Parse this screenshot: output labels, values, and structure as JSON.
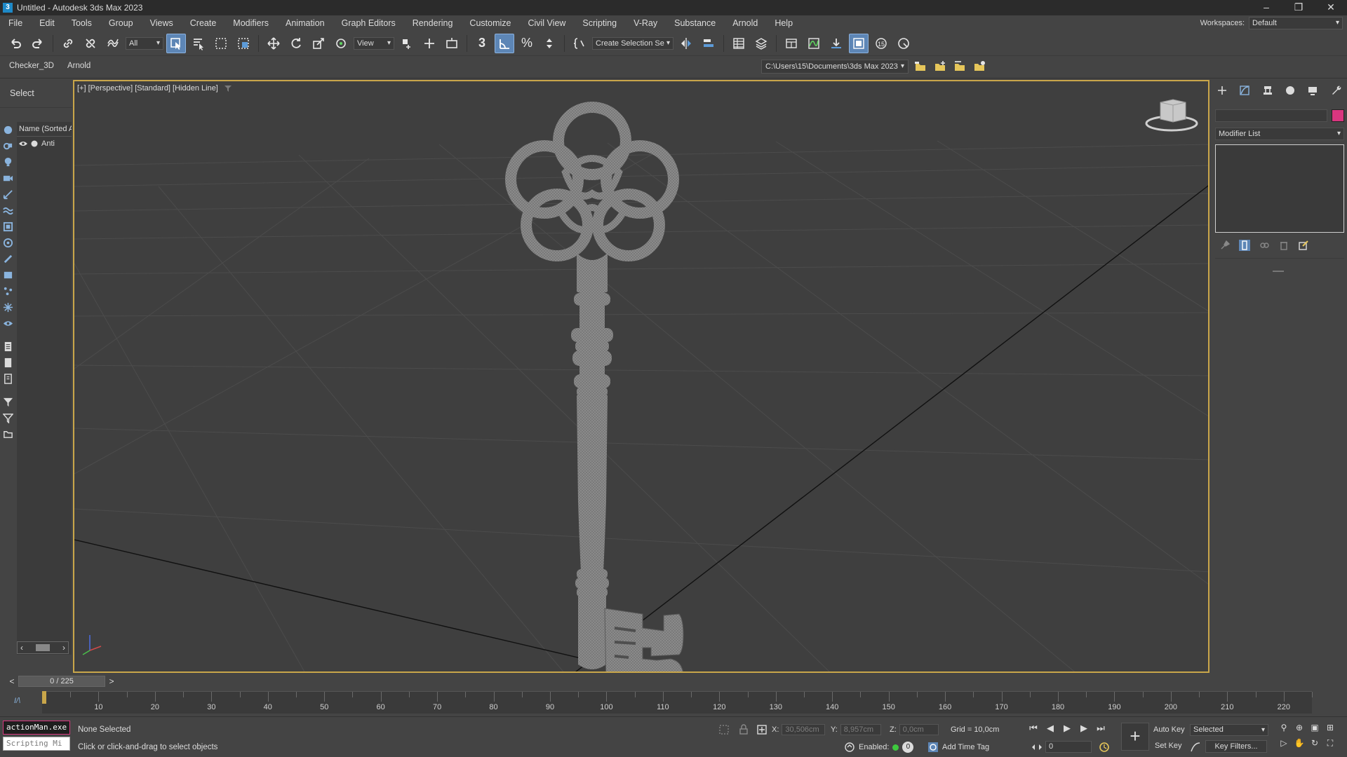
{
  "window": {
    "title": "Untitled - Autodesk 3ds Max 2023",
    "app_badge": "3"
  },
  "menu": [
    "File",
    "Edit",
    "Tools",
    "Group",
    "Views",
    "Create",
    "Modifiers",
    "Animation",
    "Graph Editors",
    "Rendering",
    "Customize",
    "Civil View",
    "Scripting",
    "V-Ray",
    "Substance",
    "Arnold",
    "Help"
  ],
  "workspace": {
    "label": "Workspaces:",
    "value": "Default"
  },
  "toolbar": {
    "filter_value": "All",
    "refcoord_value": "View",
    "selection_set_value": "Create Selection Se",
    "snap_label": "3",
    "spinner_label": "15"
  },
  "ribbon": {
    "tabs": [
      "Checker_3D",
      "Arnold"
    ],
    "project_path": "C:\\Users\\15\\Documents\\3ds Max 2023"
  },
  "scene_explorer": {
    "title": "Select",
    "column_header": "Name (Sorted A",
    "rows": [
      {
        "name": "Anti"
      }
    ]
  },
  "viewport": {
    "label": "[+] [Perspective] [Standard] [Hidden Line]"
  },
  "command_panel": {
    "modifier_list": "Modifier List",
    "object_color": "#d9367f"
  },
  "time_slider": {
    "position": "0 / 225",
    "prev": "<",
    "next": ">"
  },
  "track_bar": {
    "ticks": [
      "10",
      "20",
      "30",
      "40",
      "50",
      "60",
      "70",
      "80",
      "90",
      "100",
      "110",
      "120",
      "130",
      "140",
      "150",
      "160",
      "170",
      "180",
      "190",
      "200",
      "210",
      "220"
    ],
    "curve_label": "I/\\"
  },
  "status": {
    "maxscript_line1": "actionMan.exe",
    "maxscript_line2": "Scripting Mi",
    "selection": "None Selected",
    "prompt": "Click or click-and-drag to select objects",
    "x_label": "X:",
    "x_value": "30,506cm",
    "y_label": "Y:",
    "y_value": "8,957cm",
    "z_label": "Z:",
    "z_value": "0,0cm",
    "grid": "Grid = 10,0cm",
    "enabled_label": "Enabled:",
    "enabled_badge": "0",
    "add_time_tag": "Add Time Tag",
    "frame_value": "0",
    "auto_key": "Auto Key",
    "set_key": "Set Key",
    "key_mode": "Selected",
    "key_filters": "Key Filters..."
  }
}
